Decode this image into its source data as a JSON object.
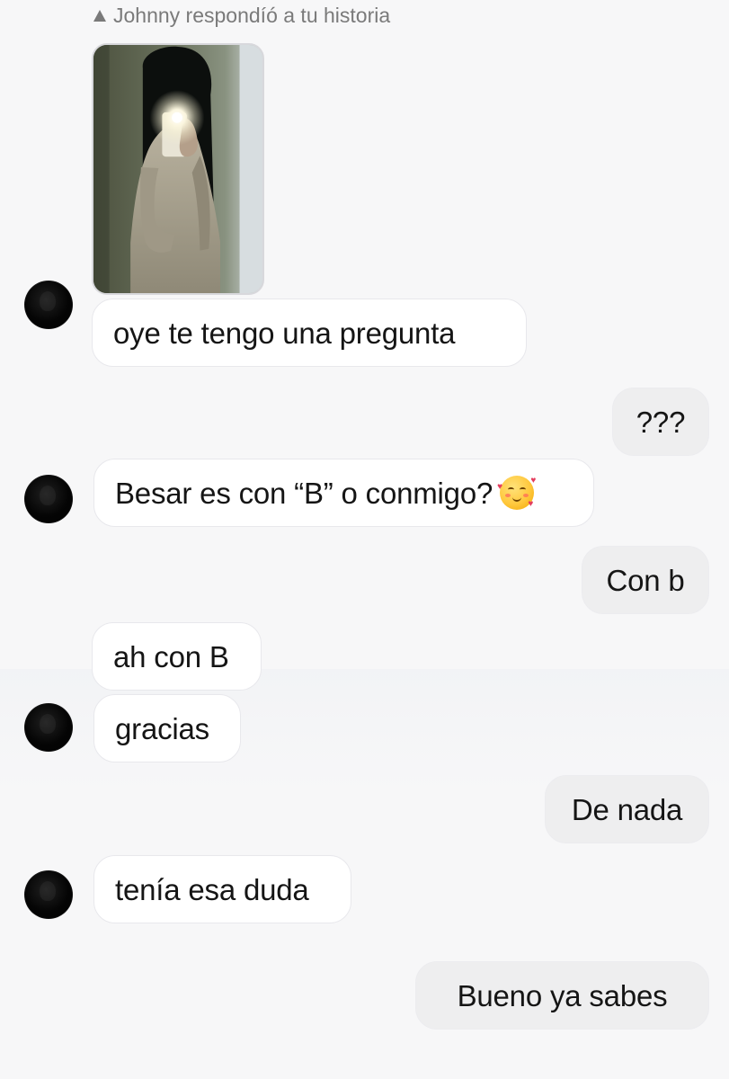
{
  "story_reply": {
    "label": "Johnny respondíó a tu historia",
    "icon": "reply-arrow-icon"
  },
  "messages": [
    {
      "direction": "incoming",
      "text": "oye te tengo una pregunta"
    },
    {
      "direction": "outgoing",
      "text": "???"
    },
    {
      "direction": "incoming",
      "text": "Besar es con “B” o conmigo?",
      "emoji": "smiling-face-with-hearts-icon"
    },
    {
      "direction": "outgoing",
      "text": "Con b"
    },
    {
      "direction": "incoming",
      "text": "ah con B"
    },
    {
      "direction": "incoming",
      "text": "gracias"
    },
    {
      "direction": "outgoing",
      "text": "De nada"
    },
    {
      "direction": "incoming",
      "text": "tenía esa duda"
    },
    {
      "direction": "outgoing",
      "text": "Bueno ya sabes"
    }
  ],
  "colors": {
    "background": "#f7f7f8",
    "incoming_bubble": "#ffffff",
    "outgoing_bubble": "#eeeeef",
    "meta_text": "#7a7a7a",
    "avatar": "#000000"
  }
}
